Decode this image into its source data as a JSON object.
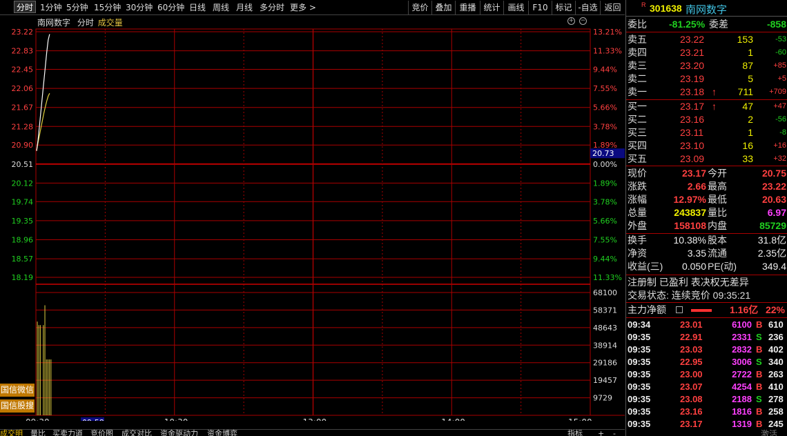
{
  "toolbar": {
    "tabs": [
      "分时",
      "1分钟",
      "5分钟",
      "15分钟",
      "30分钟",
      "60分钟",
      "日线",
      "周线",
      "月线",
      "多分时",
      "更多 >"
    ],
    "right": [
      "竞价",
      "叠加",
      "重播",
      "统计",
      "画线",
      "F10",
      "标记",
      "-自选",
      "返回"
    ]
  },
  "chart": {
    "legend_name": "南网数字",
    "legend_mode": "分时",
    "legend_vol": "成交量",
    "price_ticks": [
      "23.22",
      "22.83",
      "22.45",
      "22.06",
      "21.67",
      "21.28",
      "20.90",
      "20.51",
      "20.12",
      "19.74",
      "19.35",
      "18.96",
      "18.57",
      "18.19"
    ],
    "pct_ticks": [
      "13.21%",
      "11.33%",
      "9.44%",
      "7.55%",
      "5.66%",
      "3.78%",
      "1.89%",
      "0.00%",
      "1.89%",
      "3.78%",
      "5.66%",
      "7.55%",
      "9.44%",
      "11.33%"
    ],
    "vol_ticks": [
      "68100",
      "58371",
      "48643",
      "38914",
      "29186",
      "19457",
      "9729"
    ],
    "time_ticks": [
      "09:30",
      "10:30",
      "13:00",
      "14:00",
      "15:00"
    ],
    "cursor_time": "09:58",
    "cursor_price": "20.73",
    "side_buttons": [
      "国信微信",
      "国信股搜"
    ]
  },
  "chart_data": {
    "type": "line",
    "prev_close": 20.51,
    "ylim": [
      18.19,
      23.22
    ],
    "vol_max": 68100,
    "price": [
      20.78,
      21.0,
      21.3,
      21.6,
      21.9,
      22.2,
      22.5,
      22.8,
      23.05,
      23.17
    ],
    "avg": [
      20.78,
      20.95,
      21.1,
      21.25,
      21.4,
      21.55,
      21.68,
      21.8,
      21.9,
      21.96
    ],
    "volume": [
      52000,
      50000,
      50000,
      0,
      50000,
      61000,
      31000,
      31000,
      31000,
      31000
    ]
  },
  "bottom": {
    "tabs": [
      "成交明",
      "量比",
      "买卖力道",
      "竞价图",
      "成交对比",
      "资金驱动力",
      "资金博弈"
    ],
    "right": [
      "指标",
      "+",
      "-"
    ]
  },
  "stock": {
    "badge": "R",
    "code": "301638",
    "name": "南网数字"
  },
  "weibi": {
    "label": "委比",
    "value": "-81.25%",
    "label2": "委差",
    "value2": "-858"
  },
  "asks": [
    {
      "label": "卖五",
      "price": "23.22",
      "vol": "153",
      "chg": "-53",
      "arrow": ""
    },
    {
      "label": "卖四",
      "price": "23.21",
      "vol": "1",
      "chg": "-60",
      "arrow": ""
    },
    {
      "label": "卖三",
      "price": "23.20",
      "vol": "87",
      "chg": "+85",
      "arrow": ""
    },
    {
      "label": "卖二",
      "price": "23.19",
      "vol": "5",
      "chg": "+5",
      "arrow": ""
    },
    {
      "label": "卖一",
      "price": "23.18",
      "vol": "711",
      "chg": "+709",
      "arrow": "↑"
    }
  ],
  "bids": [
    {
      "label": "买一",
      "price": "23.17",
      "vol": "47",
      "chg": "+47",
      "arrow": "↑"
    },
    {
      "label": "买二",
      "price": "23.16",
      "vol": "2",
      "chg": "-56",
      "arrow": ""
    },
    {
      "label": "买三",
      "price": "23.11",
      "vol": "1",
      "chg": "-8",
      "arrow": ""
    },
    {
      "label": "买四",
      "price": "23.10",
      "vol": "16",
      "chg": "+16",
      "arrow": ""
    },
    {
      "label": "买五",
      "price": "23.09",
      "vol": "33",
      "chg": "+32",
      "arrow": ""
    }
  ],
  "quote": [
    [
      "现价",
      "23.17",
      "今开",
      "20.75"
    ],
    [
      "涨跌",
      "2.66",
      "最高",
      "23.22"
    ],
    [
      "涨幅",
      "12.97%",
      "最低",
      "20.63"
    ],
    [
      "总量",
      "243837",
      "量比",
      "6.97"
    ],
    [
      "外盘",
      "158108",
      "内盘",
      "85729"
    ]
  ],
  "stats": [
    [
      "换手",
      "10.38%",
      "股本",
      "31.8亿"
    ],
    [
      "净资",
      "3.35",
      "流通",
      "2.35亿"
    ],
    [
      "收益(三)",
      "0.050",
      "PE(动)",
      "349.4"
    ]
  ],
  "info": {
    "tags": "注册制 已盈利 表决权无差异",
    "status": "交易状态: 连续竞价 09:35:21"
  },
  "main_flow": {
    "label": "主力净额",
    "value": "1.16亿",
    "pct": "22%"
  },
  "ticks": [
    [
      "09:34",
      "23.01",
      "6100",
      "B",
      "610"
    ],
    [
      "09:35",
      "22.91",
      "2331",
      "S",
      "236"
    ],
    [
      "09:35",
      "23.03",
      "2832",
      "B",
      "402"
    ],
    [
      "09:35",
      "22.95",
      "3006",
      "S",
      "340"
    ],
    [
      "09:35",
      "23.00",
      "2722",
      "B",
      "263"
    ],
    [
      "09:35",
      "23.07",
      "4254",
      "B",
      "410"
    ],
    [
      "09:35",
      "23.08",
      "2188",
      "S",
      "278"
    ],
    [
      "09:35",
      "23.16",
      "1816",
      "B",
      "258"
    ],
    [
      "09:35",
      "23.17",
      "1319",
      "B",
      "245"
    ]
  ],
  "tick_footer": "激活"
}
